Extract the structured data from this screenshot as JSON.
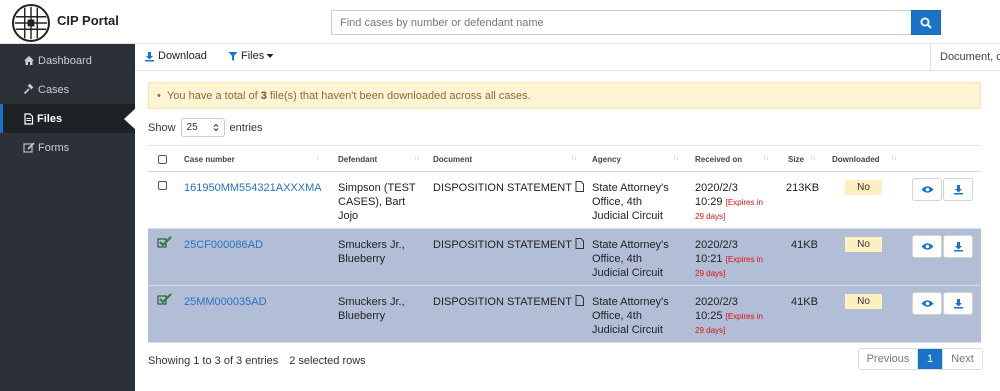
{
  "app": {
    "title": "CIP Portal"
  },
  "search": {
    "placeholder": "Find cases by number or defendant name"
  },
  "sidebar": {
    "items": [
      {
        "label": "Dashboard",
        "icon": "home-icon"
      },
      {
        "label": "Cases",
        "icon": "gavel-icon"
      },
      {
        "label": "Files",
        "icon": "file-icon",
        "active": true
      },
      {
        "label": "Forms",
        "icon": "edit-icon"
      }
    ]
  },
  "toolbar": {
    "download_label": "Download",
    "files_filter_label": "Files",
    "right_text": "Document, d"
  },
  "alert": {
    "prefix": "You have a total of ",
    "count": "3",
    "suffix": " file(s) that haven't been downloaded across all cases."
  },
  "length": {
    "show": "Show",
    "value": "25",
    "entries": "entries"
  },
  "table": {
    "columns": [
      "Case number",
      "Defendant",
      "Document",
      "Agency",
      "Received on",
      "Size",
      "Downloaded"
    ],
    "rows": [
      {
        "case": "161950MM554321AXXXMA",
        "defendant_l1": "Simpson (TEST",
        "defendant_l2": "CASES), Bart",
        "defendant_l3": "Jojo",
        "document": "DISPOSITION STATEMENT",
        "agency_l1": "State Attorney's",
        "agency_l2": "Office, 4th",
        "agency_l3": "Judicial Circuit",
        "date": "2020/2/3",
        "time": "10:29",
        "exp_l1": "[Expires in",
        "exp_l2": "29 days]",
        "size": "213KB",
        "downloaded": "No",
        "selected": false
      },
      {
        "case": "25CF000086AD",
        "defendant_l1": "Smuckers Jr.,",
        "defendant_l2": "Blueberry",
        "document": "DISPOSITION STATEMENT",
        "agency_l1": "State Attorney's",
        "agency_l2": "Office, 4th",
        "agency_l3": "Judicial Circuit",
        "date": "2020/2/3",
        "time": "10:21",
        "exp_l1": "[Expires in",
        "exp_l2": "29 days]",
        "size": "41KB",
        "downloaded": "No",
        "selected": true
      },
      {
        "case": "25MM000035AD",
        "defendant_l1": "Smuckers Jr.,",
        "defendant_l2": "Blueberry",
        "document": "DISPOSITION STATEMENT",
        "agency_l1": "State Attorney's",
        "agency_l2": "Office, 4th",
        "agency_l3": "Judicial Circuit",
        "date": "2020/2/3",
        "time": "10:25",
        "exp_l1": "[Expires in",
        "exp_l2": "29 days]",
        "size": "41KB",
        "downloaded": "No",
        "selected": true
      }
    ]
  },
  "footer": {
    "info": "Showing 1 to 3 of 3 entries",
    "selected": "2 selected rows",
    "prev": "Previous",
    "page": "1",
    "next": "Next"
  },
  "colors": {
    "accent": "#1a73c9",
    "sidebar": "#2b3136",
    "selected_row": "#b2bdd6",
    "alert_bg": "#fcf4d3"
  }
}
